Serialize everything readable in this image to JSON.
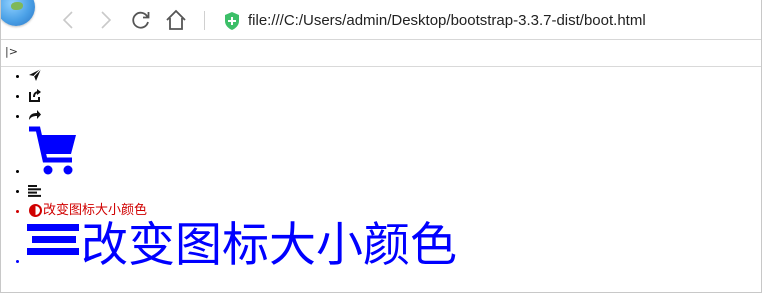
{
  "browser": {
    "url": "file:///C:/Users/admin/Desktop/bootstrap-3.3.7-dist/boot.html",
    "toolbar_icons": [
      "browser-logo-icon",
      "back-icon",
      "forward-icon",
      "reload-icon",
      "home-icon",
      "secure-shield-icon"
    ]
  },
  "page": {
    "sidebar_toggle_glyph": "|>",
    "list_items": [
      {
        "icon": "send-icon"
      },
      {
        "icon": "share-icon"
      },
      {
        "icon": "forward-arrow-icon"
      },
      {
        "icon": "shopping-cart-icon",
        "color": "#0000ff"
      },
      {
        "icon": "align-left-icon"
      },
      {
        "icon": "adjust-icon",
        "color": "#d00000",
        "label": "改变图标大小颜色"
      },
      {
        "icon": "align-justify-icon",
        "color": "#0000ff",
        "label": "改变图标大小颜色"
      }
    ]
  }
}
